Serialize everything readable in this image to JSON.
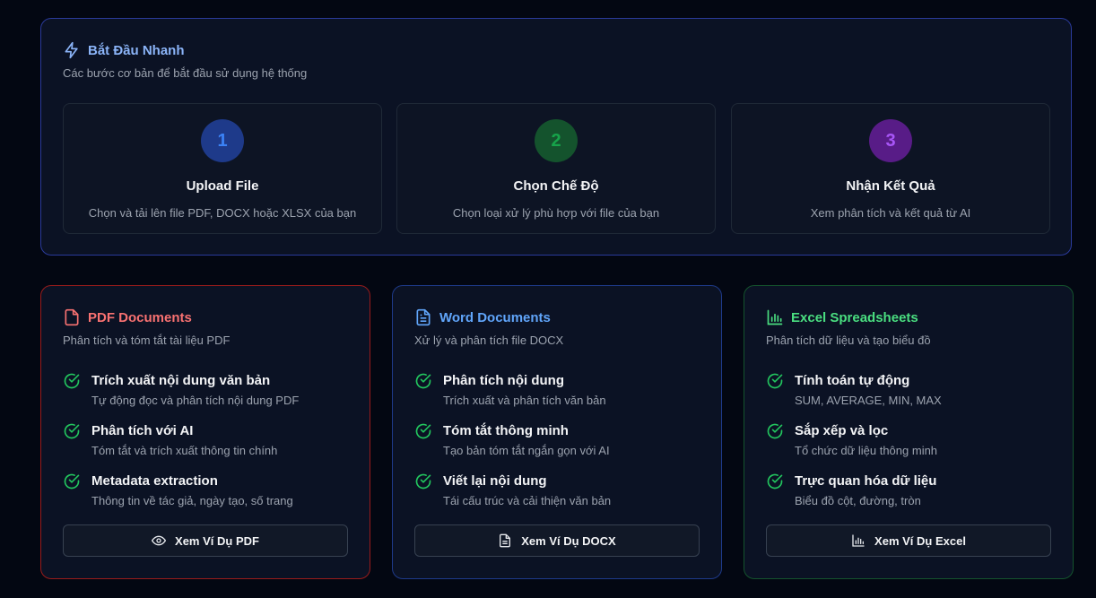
{
  "quick_start": {
    "title": "Bắt Đầu Nhanh",
    "subtitle": "Các bước cơ bản để bắt đầu sử dụng hệ thống",
    "steps": [
      {
        "number": "1",
        "title": "Upload File",
        "desc": "Chọn và tải lên file PDF, DOCX hoặc XLSX của bạn",
        "color": "#2563eb"
      },
      {
        "number": "2",
        "title": "Chọn Chế Độ",
        "desc": "Chọn loại xử lý phù hợp với file của bạn",
        "color": "#16a34a"
      },
      {
        "number": "3",
        "title": "Nhận Kết Quả",
        "desc": "Xem phân tích và kết quả từ AI",
        "color": "#9333ea"
      }
    ]
  },
  "cards": [
    {
      "title": "PDF Documents",
      "subtitle": "Phân tích và tóm tắt tài liệu PDF",
      "accent": "#f87171",
      "border": "#991b1b",
      "icon": "file-icon",
      "features": [
        {
          "title": "Trích xuất nội dung văn bản",
          "desc": "Tự động đọc và phân tích nội dung PDF"
        },
        {
          "title": "Phân tích với AI",
          "desc": "Tóm tắt và trích xuất thông tin chính"
        },
        {
          "title": "Metadata extraction",
          "desc": "Thông tin về tác giả, ngày tạo, số trang"
        }
      ],
      "button": "Xem Ví Dụ PDF",
      "button_icon": "eye-icon"
    },
    {
      "title": "Word Documents",
      "subtitle": "Xử lý và phân tích file DOCX",
      "accent": "#60a5fa",
      "border": "#1e3a8a",
      "icon": "document-text-icon",
      "features": [
        {
          "title": "Phân tích nội dung",
          "desc": "Trích xuất và phân tích văn bản"
        },
        {
          "title": "Tóm tắt thông minh",
          "desc": "Tạo bản tóm tắt ngắn gọn với AI"
        },
        {
          "title": "Viết lại nội dung",
          "desc": "Tái cấu trúc và cải thiện văn bản"
        }
      ],
      "button": "Xem Ví Dụ DOCX",
      "button_icon": "document-text-icon"
    },
    {
      "title": "Excel Spreadsheets",
      "subtitle": "Phân tích dữ liệu và tạo biểu đồ",
      "accent": "#4ade80",
      "border": "#14532d",
      "icon": "bar-chart-icon",
      "features": [
        {
          "title": "Tính toán tự động",
          "desc": "SUM, AVERAGE, MIN, MAX"
        },
        {
          "title": "Sắp xếp và lọc",
          "desc": "Tổ chức dữ liệu thông minh"
        },
        {
          "title": "Trực quan hóa dữ liệu",
          "desc": "Biểu đồ cột, đường, tròn"
        }
      ],
      "button": "Xem Ví Dụ Excel",
      "button_icon": "bar-chart-icon"
    }
  ],
  "check_color": "#22c55e"
}
